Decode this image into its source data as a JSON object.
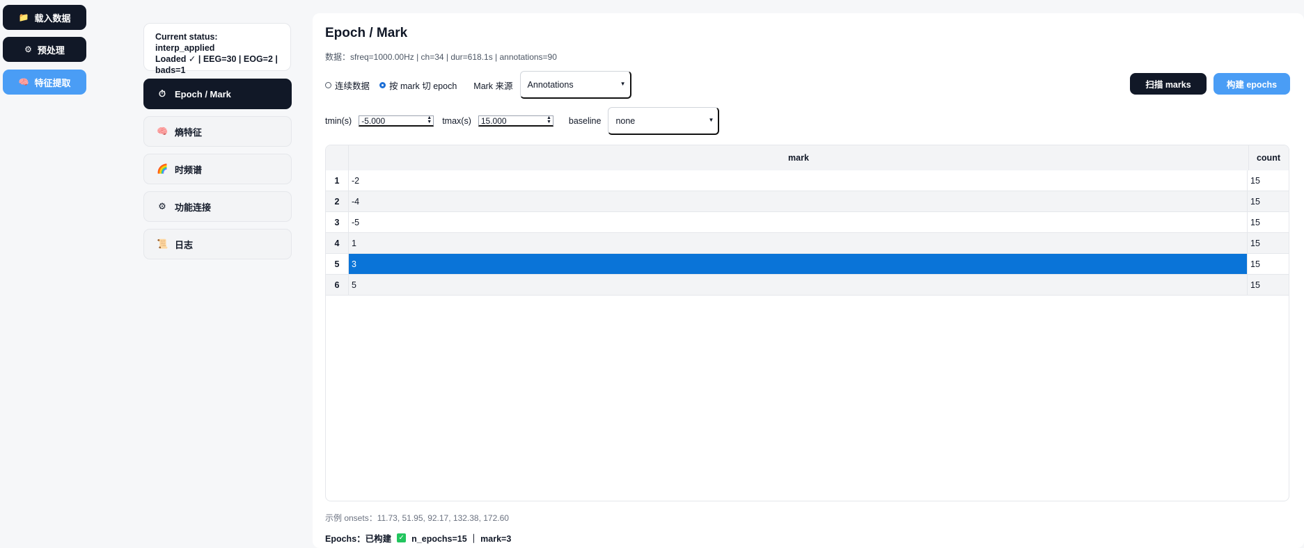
{
  "left_nav": [
    {
      "icon": "folder-icon",
      "glyph": "📁",
      "label": "载入数据",
      "active": false
    },
    {
      "icon": "gear-icon",
      "glyph": "⚙",
      "label": "预处理",
      "active": false
    },
    {
      "icon": "brain-icon",
      "glyph": "🧠",
      "label": "特征提取",
      "active": true
    }
  ],
  "status": {
    "line1": "Current status: interp_applied",
    "line2": "Loaded ✓ | EEG=30 | EOG=2 |",
    "line3": "bads=1"
  },
  "sidebar": [
    {
      "icon": "stopwatch-icon",
      "glyph": "⏱",
      "label": "Epoch / Mark",
      "active": true
    },
    {
      "icon": "brain-icon",
      "glyph": "🧠",
      "label": "熵特征",
      "active": false
    },
    {
      "icon": "rainbow-icon",
      "glyph": "🌈",
      "label": "时频谱",
      "active": false
    },
    {
      "icon": "gear-icon",
      "glyph": "⚙",
      "label": "功能连接",
      "active": false
    },
    {
      "icon": "scroll-icon",
      "glyph": "📜",
      "label": "日志",
      "active": false
    }
  ],
  "main": {
    "title": "Epoch / Mark",
    "info": "数据：sfreq=1000.00Hz | ch=34 | dur=618.1s | annotations=90",
    "mode_continuous": "连续数据",
    "mode_mark": "按 mark 切 epoch",
    "mode_selected": "mark",
    "mark_source_label": "Mark 来源",
    "mark_source_value": "Annotations",
    "scan_button": "扫描 marks",
    "build_button": "构建 epochs",
    "tmin_label": "tmin(s)",
    "tmin_value": "-5.000",
    "tmax_label": "tmax(s)",
    "tmax_value": "15.000",
    "baseline_label": "baseline",
    "baseline_value": "none",
    "table": {
      "columns": [
        "mark",
        "count"
      ],
      "rows": [
        {
          "index": "1",
          "mark": "-2",
          "count": "15"
        },
        {
          "index": "2",
          "mark": "-4",
          "count": "15"
        },
        {
          "index": "3",
          "mark": "-5",
          "count": "15"
        },
        {
          "index": "4",
          "mark": "1",
          "count": "15"
        },
        {
          "index": "5",
          "mark": "3",
          "count": "15",
          "selected": true
        },
        {
          "index": "6",
          "mark": "5",
          "count": "15"
        }
      ]
    },
    "onsets": "示例 onsets：11.73, 51.95, 92.17, 132.38, 172.60",
    "epochs_prefix": "Epochs：已构建",
    "epochs_suffix": "n_epochs=15 ｜ mark=3"
  },
  "colors": {
    "dark": "#111827",
    "accent": "#4a9df5",
    "selected_row": "#0a74d8",
    "success": "#22c55e"
  }
}
